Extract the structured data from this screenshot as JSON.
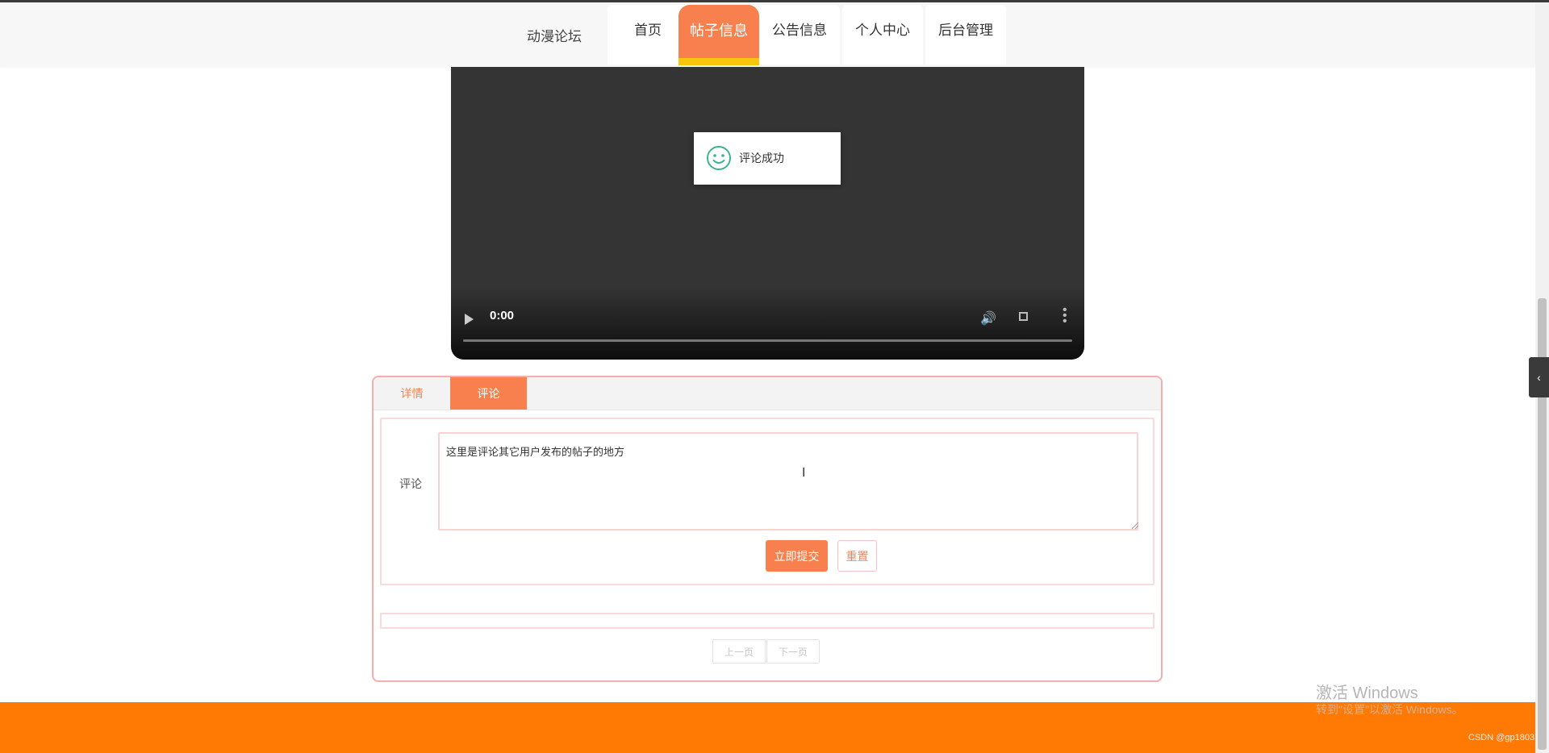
{
  "nav": {
    "brand": "动漫论坛",
    "items": [
      {
        "label": "首页"
      },
      {
        "label": "帖子信息"
      },
      {
        "label": "公告信息"
      },
      {
        "label": "个人中心"
      },
      {
        "label": "后台管理"
      }
    ],
    "active_index": 1
  },
  "video": {
    "time": "0:00",
    "icons": [
      "play-icon",
      "volume-icon",
      "fullscreen-icon",
      "more-vertical-icon"
    ]
  },
  "toast": {
    "message": "评论成功",
    "icon": "smile-icon"
  },
  "tabs": [
    {
      "label": "详情"
    },
    {
      "label": "评论"
    }
  ],
  "comment_form": {
    "label": "评论",
    "value": "这里是评论其它用户发布的帖子的地方",
    "submit_label": "立即提交",
    "reset_label": "重置"
  },
  "pager": {
    "prev_label": "上一页",
    "next_label": "下一页"
  },
  "watermark": {
    "line1": "激活 Windows",
    "line2": "转到\"设置\"以激活 Windows。"
  },
  "footer_credit": "CSDN @gp1803",
  "colors": {
    "accent": "#f7804e",
    "active_underline": "#f8c70c",
    "footer": "#ff7905",
    "toast_icon": "#3fb48b"
  }
}
